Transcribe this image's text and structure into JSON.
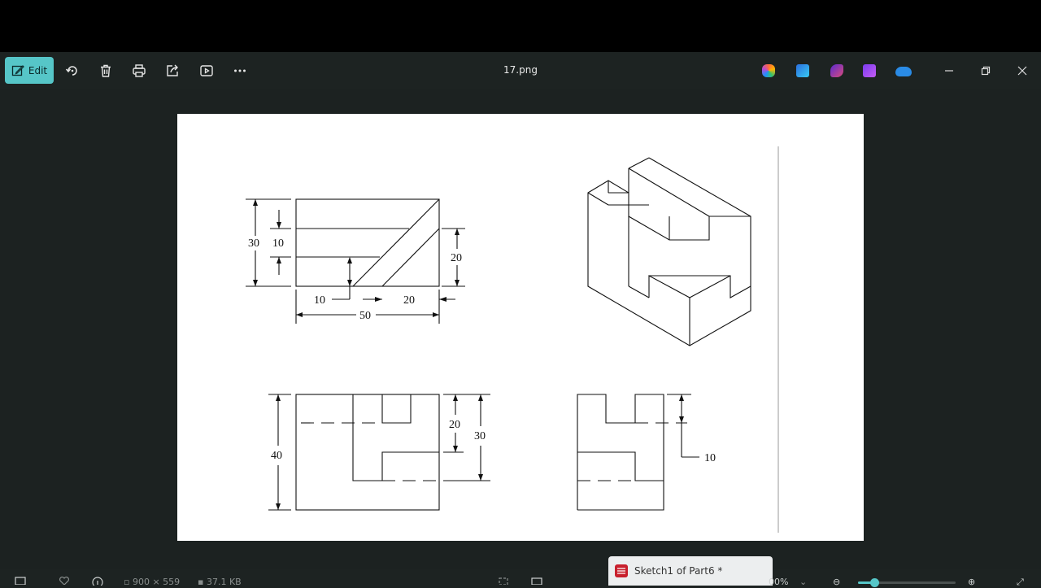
{
  "toolbar": {
    "edit_label": "Edit",
    "title": "17.png"
  },
  "drawing": {
    "dims": [
      "30",
      "10",
      "20",
      "10",
      "20",
      "50",
      "40",
      "20",
      "30",
      "10"
    ]
  },
  "status": {
    "dimensions": "900 × 559",
    "file_size": "37.1 KB",
    "zoom": "00%"
  },
  "popup": {
    "label": "Sketch1 of Part6 *"
  },
  "icons": [
    "edit-icon",
    "rotate-icon",
    "delete-icon",
    "print-icon",
    "share-icon",
    "slideshow-icon",
    "more-icon",
    "copilot-icon",
    "designer-icon",
    "clipchamp-icon",
    "video-editor-icon",
    "onedrive-icon",
    "minimize-icon",
    "restore-icon",
    "close-icon"
  ]
}
